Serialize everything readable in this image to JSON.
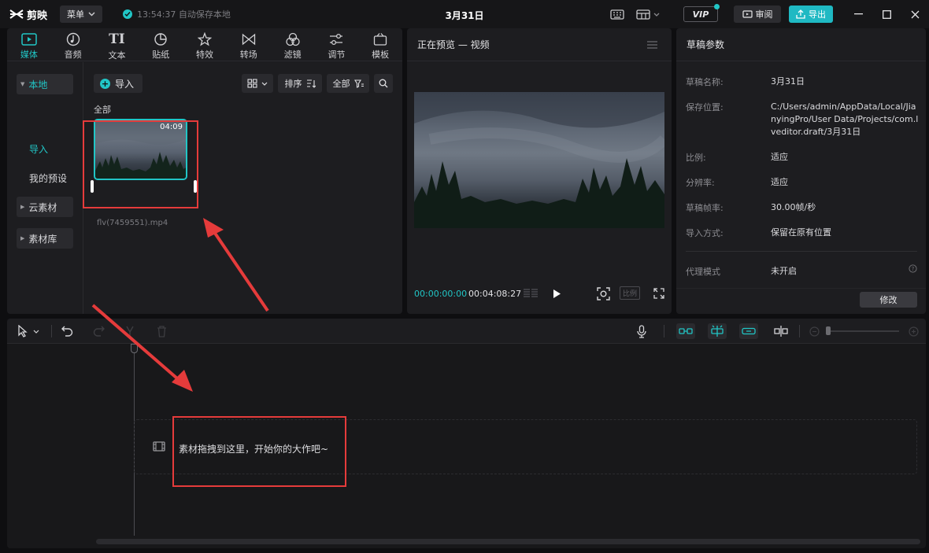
{
  "app": {
    "logo_text": "剪映",
    "menu_label": "菜单",
    "autosave_text": "13:54:37 自动保存本地",
    "project_title": "3月31日",
    "vip_label": "VIP",
    "review_label": "审阅",
    "export_label": "导出",
    "accent_color": "#21c6c6"
  },
  "media_tabs": [
    {
      "label": "媒体",
      "icon": "media-icon",
      "active": true
    },
    {
      "label": "音频",
      "icon": "audio-icon"
    },
    {
      "label": "文本",
      "icon": "text-icon"
    },
    {
      "label": "贴纸",
      "icon": "sticker-icon"
    },
    {
      "label": "特效",
      "icon": "effects-icon"
    },
    {
      "label": "转场",
      "icon": "transition-icon"
    },
    {
      "label": "滤镜",
      "icon": "filter-icon"
    },
    {
      "label": "调节",
      "icon": "adjust-icon"
    },
    {
      "label": "模板",
      "icon": "template-icon"
    }
  ],
  "sidebar": {
    "local": "本地",
    "import": "导入",
    "my_presets": "我的预设",
    "cloud": "云素材",
    "library": "素材库"
  },
  "media": {
    "import_label": "导入",
    "sort_label": "排序",
    "filter_label": "全部",
    "section_label": "全部",
    "clip_duration": "04:09",
    "clip_filename": "flv(7459551).mp4"
  },
  "preview": {
    "title": "正在预览 — 视频",
    "current_time": "00:00:00:00",
    "total_time": "00:04:08:27",
    "ratio_label": "比例"
  },
  "params": {
    "title": "草稿参数",
    "rows": [
      {
        "key": "草稿名称:",
        "value": "3月31日"
      },
      {
        "key": "保存位置:",
        "value": "C:/Users/admin/AppData/Local/JianyingPro/User Data/Projects/com.lveditor.draft/3月31日"
      },
      {
        "key": "比例:",
        "value": "适应"
      },
      {
        "key": "分辨率:",
        "value": "适应"
      },
      {
        "key": "草稿帧率:",
        "value": "30.00帧/秒"
      },
      {
        "key": "导入方式:",
        "value": "保留在原有位置"
      }
    ],
    "proxy_key": "代理模式",
    "proxy_value": "未开启",
    "modify_label": "修改"
  },
  "timeline": {
    "drop_hint": "素材拖拽到这里，开始你的大作吧~"
  }
}
